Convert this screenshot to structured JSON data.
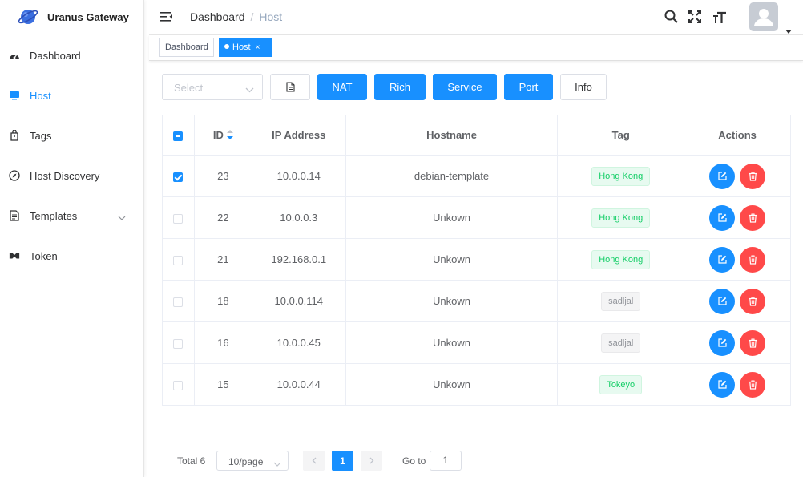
{
  "app": {
    "title": "Uranus Gateway"
  },
  "sidebar": {
    "items": [
      {
        "label": "Dashboard",
        "icon": "dashboard-icon",
        "active": false
      },
      {
        "label": "Host",
        "icon": "monitor-icon",
        "active": true
      },
      {
        "label": "Tags",
        "icon": "tag-icon",
        "active": false
      },
      {
        "label": "Host Discovery",
        "icon": "compass-icon",
        "active": false
      },
      {
        "label": "Templates",
        "icon": "document-icon",
        "active": false,
        "has_submenu": true
      },
      {
        "label": "Token",
        "icon": "token-icon",
        "active": false
      }
    ]
  },
  "header": {
    "breadcrumb": [
      "Dashboard",
      "Host"
    ]
  },
  "tagsbar": {
    "tabs": [
      {
        "label": "Dashboard",
        "active": false
      },
      {
        "label": "Host",
        "active": true,
        "close": "×"
      }
    ]
  },
  "toolbar": {
    "select_placeholder": "Select",
    "buttons": [
      "NAT",
      "Rich",
      "Service",
      "Port",
      "Info"
    ]
  },
  "table": {
    "columns": [
      "ID",
      "IP Address",
      "Hostname",
      "Tag",
      "Actions"
    ],
    "rows": [
      {
        "checked": true,
        "id": "23",
        "ip": "10.0.0.14",
        "hostname": "debian-template",
        "tag": "Hong Kong",
        "tag_style": "green"
      },
      {
        "checked": false,
        "id": "22",
        "ip": "10.0.0.3",
        "hostname": "Unkown",
        "tag": "Hong Kong",
        "tag_style": "green"
      },
      {
        "checked": false,
        "id": "21",
        "ip": "192.168.0.1",
        "hostname": "Unkown",
        "tag": "Hong Kong",
        "tag_style": "green"
      },
      {
        "checked": false,
        "id": "18",
        "ip": "10.0.0.114",
        "hostname": "Unkown",
        "tag": "sadljal",
        "tag_style": "gray"
      },
      {
        "checked": false,
        "id": "16",
        "ip": "10.0.0.45",
        "hostname": "Unkown",
        "tag": "sadljal",
        "tag_style": "gray"
      },
      {
        "checked": false,
        "id": "15",
        "ip": "10.0.0.44",
        "hostname": "Unkown",
        "tag": "Tokeyo",
        "tag_style": "green"
      }
    ]
  },
  "pagination": {
    "total": "Total 6",
    "page_size": "10/page",
    "current_page": "1",
    "goto_label": "Go to",
    "goto_value": "1"
  },
  "colors": {
    "primary": "#1890ff",
    "danger": "#ff4949",
    "success": "#13ce66"
  }
}
